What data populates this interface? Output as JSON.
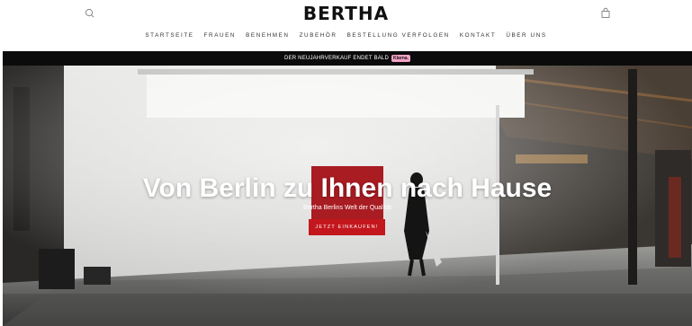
{
  "header": {
    "logo": "BERTHA",
    "search_icon": "search-icon",
    "cart_icon": "shopping-bag-icon"
  },
  "nav": {
    "items": [
      {
        "label": "STARTSEITE"
      },
      {
        "label": "FRAUEN"
      },
      {
        "label": "BENEHMEN"
      },
      {
        "label": "ZUBEHÖR"
      },
      {
        "label": "BESTELLUNG VERFOLGEN"
      },
      {
        "label": "KONTAKT"
      },
      {
        "label": "ÜBER UNS"
      }
    ]
  },
  "announcement": {
    "text": "DER NEUJAHRVERKAUF ENDET BALD",
    "badge": "Klarna.",
    "badge_color": "#f5a3c7"
  },
  "hero": {
    "title": "Von Berlin zu Ihnen nach Hause",
    "subtitle": "Bertha Berlins Welt der Qualität",
    "cta_label": "JETZT EINKAUFEN!",
    "cta_color": "#c4171d"
  }
}
